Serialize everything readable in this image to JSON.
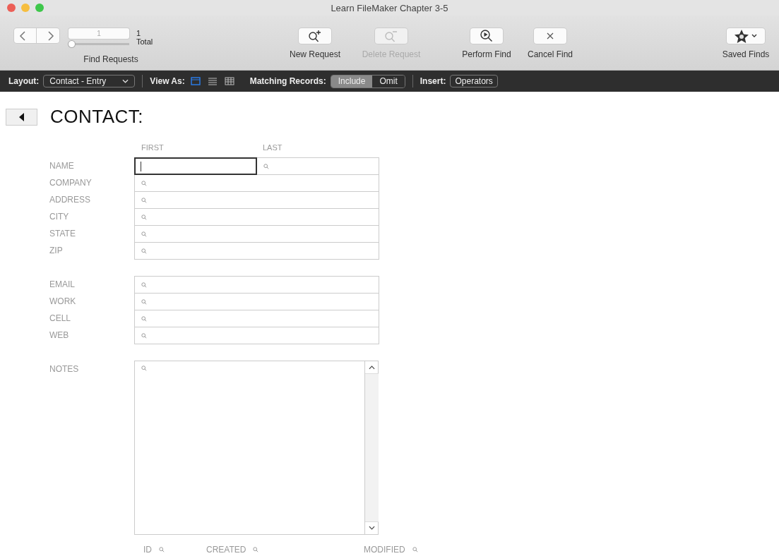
{
  "window": {
    "title": "Learn FileMaker Chapter 3-5"
  },
  "toolbar": {
    "find_requests": {
      "value": "1",
      "count": "1",
      "total": "Total",
      "level": 0,
      "label": "Find Requests"
    },
    "buttons": [
      {
        "kind": "new",
        "label": "New Request",
        "disabled": false
      },
      {
        "kind": "delete",
        "label": "Delete Request",
        "disabled": true
      },
      {
        "kind": "perform",
        "label": "Perform Find",
        "disabled": false
      },
      {
        "kind": "cancel",
        "label": "Cancel Find",
        "disabled": false
      }
    ],
    "saved_finds": {
      "label": "Saved Finds"
    }
  },
  "layout_bar": {
    "layout_label": "Layout:",
    "layout": "Contact - Entry",
    "view_as_label": "View As:",
    "views": [
      {
        "kind": "form",
        "selected": true
      },
      {
        "kind": "list",
        "selected": false
      },
      {
        "kind": "table",
        "selected": false
      }
    ],
    "matching_label": "Matching Records:",
    "matching": [
      {
        "label": "Include",
        "selected": true
      },
      {
        "label": "Omit",
        "selected": false
      }
    ],
    "insert_label": "Insert:",
    "insert": "Operators"
  },
  "form": {
    "title": "CONTACT:",
    "columns": [
      "FIRST",
      "LAST"
    ],
    "groups": [
      {
        "rows": [
          {
            "label": "NAME",
            "fields": [
              {
                "focused": true
              },
              {
                "focused": false
              }
            ]
          },
          {
            "label": "COMPANY",
            "fields": [
              {
                "focused": false
              }
            ]
          },
          {
            "label": "ADDRESS",
            "fields": [
              {
                "focused": false
              }
            ]
          },
          {
            "label": "CITY",
            "fields": [
              {
                "focused": false
              }
            ]
          },
          {
            "label": "STATE",
            "fields": [
              {
                "focused": false
              }
            ]
          },
          {
            "label": "ZIP",
            "fields": [
              {
                "focused": false
              }
            ]
          }
        ]
      },
      {
        "rows": [
          {
            "label": "EMAIL",
            "fields": [
              {
                "focused": false
              }
            ]
          },
          {
            "label": "WORK",
            "fields": [
              {
                "focused": false
              }
            ]
          },
          {
            "label": "CELL",
            "fields": [
              {
                "focused": false
              }
            ]
          },
          {
            "label": "WEB",
            "fields": [
              {
                "focused": false
              }
            ]
          }
        ]
      }
    ],
    "notes": {
      "label": "NOTES"
    },
    "footer": [
      {
        "label": "ID"
      },
      {
        "label": "CREATED"
      },
      {
        "label": "MODIFIED"
      }
    ]
  }
}
